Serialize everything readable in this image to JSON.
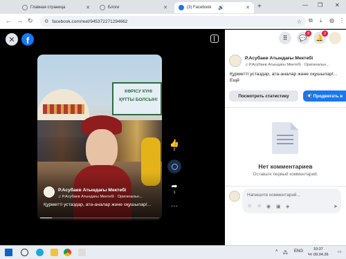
{
  "browser": {
    "tabs": [
      {
        "label": "Главная страница",
        "active": false
      },
      {
        "label": "Блоги",
        "active": false
      },
      {
        "label": "(3) Facebook",
        "active": true
      }
    ],
    "url": "facebook.com/reel/945372271294662"
  },
  "viewer": {
    "banner_line1": "КӨРІСУ КҮНІ",
    "banner_line2": "ҚҰТТЫ БОЛСЫН!",
    "author": "Р.Асубаев Атындағы Мектебі",
    "audio": "Р.Асубаев Атындағы Мектебі · Оригинальн...",
    "caption": "Құрметті устаздар, ата-аналар және оқушылар!...",
    "likes": "2",
    "shares": "1",
    "progress": 0.1
  },
  "panel": {
    "notifications_badge": "2",
    "messenger_badge": "9",
    "author": "Р.Асубаев Атындағы Мектебі",
    "audio": "Р.Асубаев Атындағы Мектебі · Оригинальн...",
    "caption": "Құрметті устаздар, ата-аналар және оқушылар!... Ещё",
    "stats_button": "Посмотреть статистику",
    "promote_button": "Продвигать в",
    "no_comments_title": "Нет комментариев",
    "no_comments_sub": "Оставьте первый комментарий.",
    "comment_placeholder": "Напишите комментарий..."
  },
  "taskbar": {
    "lang": "ENG",
    "time": "10:37",
    "date": "Чт 09.04.26"
  },
  "colors": {
    "facebook_blue": "#1877f2",
    "badge_red": "#e41e3f"
  }
}
